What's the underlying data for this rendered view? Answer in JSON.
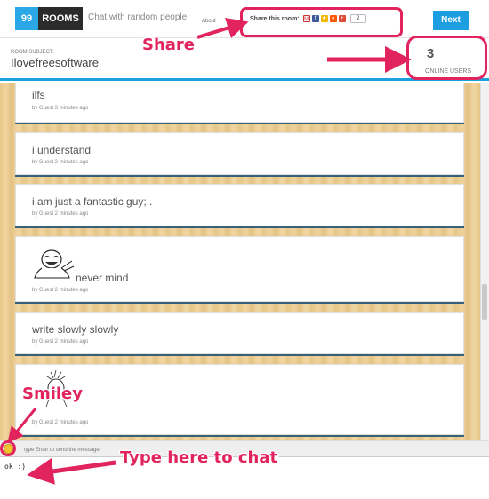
{
  "header": {
    "logo_number": "99",
    "logo_word": "ROOMS",
    "tagline": "Chat with random people.",
    "about_link": "About",
    "share_label": "Share this room:",
    "share_icons": [
      "gmail-icon",
      "facebook-icon",
      "star-icon",
      "reddit-icon",
      "google-plus-icon"
    ],
    "share_count": "2",
    "next_button": "Next"
  },
  "room": {
    "subject_caption": "ROOM SUBJECT:",
    "subject_name": "Ilovefreesoftware",
    "online_count": "3",
    "online_label": "ONLINE USERS"
  },
  "messages": [
    {
      "text": "ilfs",
      "meta": "by Guest 3 minutes ago"
    },
    {
      "text": "i understand",
      "meta": "by Guest 2 minutes ago"
    },
    {
      "text": "i am just a fantastic guy;..",
      "meta": "by Guest 2 minutes ago"
    },
    {
      "text": "never mind",
      "meta": "by Guest 2 minutes ago",
      "image": "meme-face"
    },
    {
      "text": "write slowly slowly",
      "meta": "by Guest 2 minutes ago"
    },
    {
      "text": "",
      "meta": "by Guest 2 minutes ago",
      "image": "meme-face"
    }
  ],
  "composer": {
    "hint": "type Enter to send the message",
    "value": "ok :)"
  },
  "annotations": {
    "share": "Share",
    "smiley": "Smiley",
    "type_here": "Type here to chat"
  },
  "colors": {
    "accent_blue": "#1d9ee0",
    "annotation_pink": "#e1245e",
    "wood": "#e7c88a"
  }
}
